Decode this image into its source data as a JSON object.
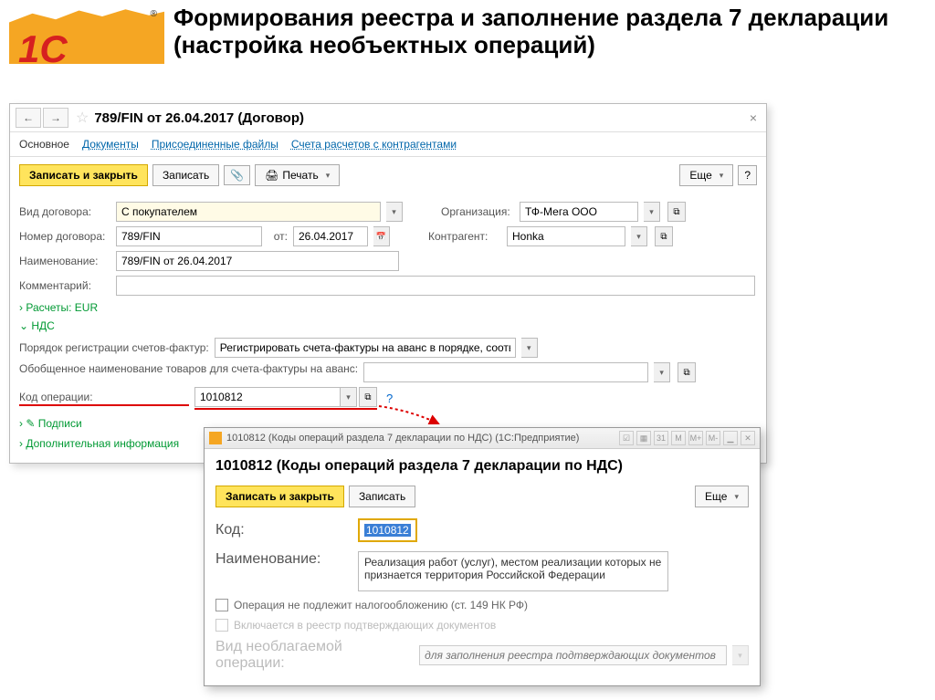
{
  "slide": {
    "logo_text": "1С",
    "title": "Формирования реестра и заполнение раздела 7 декларации (настройка необъектных операций)"
  },
  "win1": {
    "title": "789/FIN от 26.04.2017 (Договор)",
    "tabs": {
      "main": "Основное",
      "docs": "Документы",
      "files": "Присоединенные файлы",
      "accounts": "Счета расчетов с контрагентами"
    },
    "toolbar": {
      "save_close": "Записать и закрыть",
      "save": "Записать",
      "print": "Печать",
      "more": "Еще",
      "help": "?"
    },
    "labels": {
      "contract_type": "Вид договора:",
      "org": "Организация:",
      "contract_no": "Номер договора:",
      "from": "от:",
      "counterparty": "Контрагент:",
      "name": "Наименование:",
      "comment": "Комментарий:",
      "reg_order": "Порядок регистрации счетов-фактур:",
      "gen_name": "Обобщенное наименование товаров для счета-фактуры на аванс:",
      "op_code": "Код операции:"
    },
    "values": {
      "contract_type": "С покупателем",
      "org": "ТФ-Мега ООО",
      "contract_no": "789/FIN",
      "date": "26.04.2017",
      "counterparty": "Honka",
      "name": "789/FIN от 26.04.2017",
      "reg_order": "Регистрировать счета-фактуры на аванс в порядке, соответству",
      "op_code": "1010812"
    },
    "links": {
      "settlements": "Расчеты: EUR",
      "vat": "НДС",
      "signs": "Подписи",
      "extra": "Дополнительная информация"
    }
  },
  "win2": {
    "titlebar": "1010812 (Коды операций раздела 7 декларации по НДС) (1С:Предприятие)",
    "heading": "1010812 (Коды операций раздела 7 декларации по НДС)",
    "toolbar": {
      "save_close": "Записать и закрыть",
      "save": "Записать",
      "more": "Еще"
    },
    "labels": {
      "code": "Код:",
      "name": "Наименование:",
      "nontax_kind": "Вид необлагаемой операции:"
    },
    "values": {
      "code": "1010812",
      "name": "Реализация работ (услуг), местом реализации которых не признается территория Российской Федерации"
    },
    "checkboxes": {
      "not_taxable": "Операция не подлежит налогообложению (ст. 149 НК РФ)",
      "include_registry": "Включается в реестр подтверждающих документов"
    },
    "placeholder": "для заполнения реестра подтверждающих документов",
    "tb_markers": [
      "M",
      "M+",
      "M-"
    ]
  }
}
